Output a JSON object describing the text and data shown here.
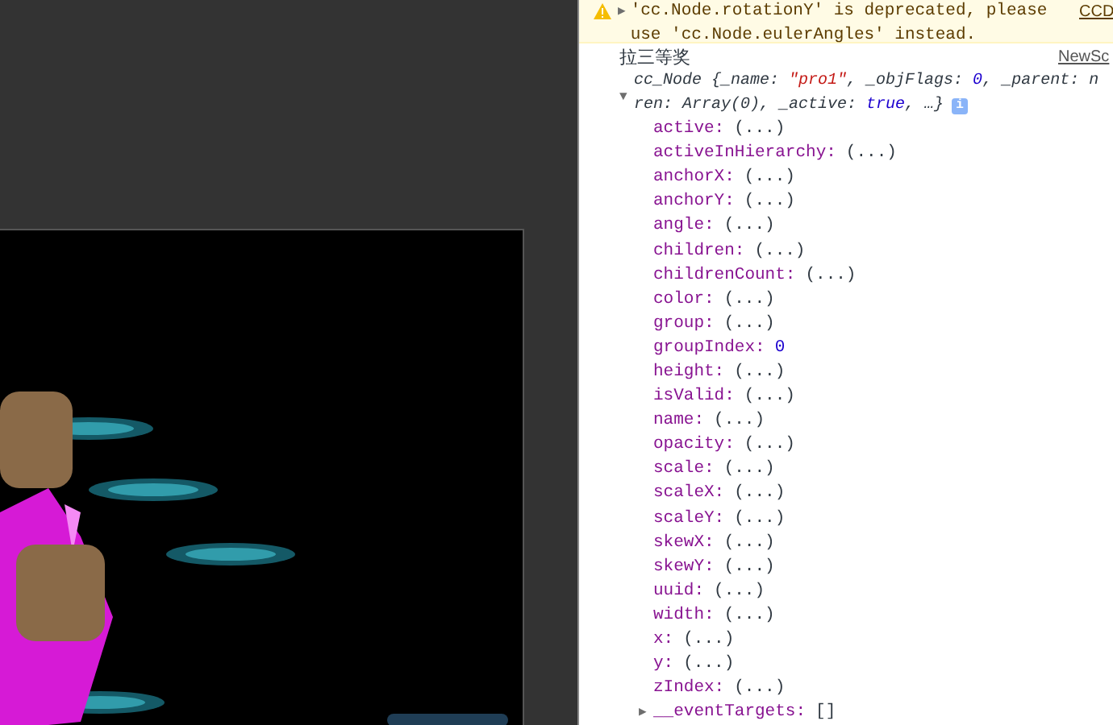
{
  "warning": {
    "expand": "▶",
    "text": "'cc.Node.rotationY' is deprecated, please use 'cc.Node.eulerAngles' instead.",
    "source": "CCD"
  },
  "log": {
    "text": "拉三等奖",
    "source": "NewSc"
  },
  "object": {
    "expanded": true,
    "toggle": "▼",
    "lines": [
      [
        {
          "kind": "plain",
          "text": "cc_Node {_name: "
        },
        {
          "kind": "string",
          "text": "\"pro1\""
        },
        {
          "kind": "plain",
          "text": ", _objFlags: "
        },
        {
          "kind": "number",
          "text": "0"
        },
        {
          "kind": "plain",
          "text": ", _parent: n"
        }
      ],
      [
        {
          "kind": "plain",
          "text": "ren: Array(0), _active: "
        },
        {
          "kind": "number",
          "text": "true"
        },
        {
          "kind": "plain",
          "text": ", …}"
        }
      ]
    ],
    "info": "i",
    "properties": [
      {
        "name": "active:",
        "value": "(...)",
        "kind": "getter"
      },
      {
        "name": "activeInHierarchy:",
        "value": "(...)",
        "kind": "getter"
      },
      {
        "name": "anchorX:",
        "value": "(...)",
        "kind": "getter"
      },
      {
        "name": "anchorY:",
        "value": "(...)",
        "kind": "getter"
      },
      {
        "name": "angle:",
        "value": "(...)",
        "kind": "getter"
      },
      {
        "name": "children:",
        "value": "(...)",
        "kind": "getter"
      },
      {
        "name": "childrenCount:",
        "value": "(...)",
        "kind": "getter"
      },
      {
        "name": "color:",
        "value": "(...)",
        "kind": "getter"
      },
      {
        "name": "group:",
        "value": "(...)",
        "kind": "getter"
      },
      {
        "name": "groupIndex:",
        "value": "0",
        "kind": "number"
      },
      {
        "name": "height:",
        "value": "(...)",
        "kind": "getter"
      },
      {
        "name": "isValid:",
        "value": "(...)",
        "kind": "getter"
      },
      {
        "name": "name:",
        "value": "(...)",
        "kind": "getter"
      },
      {
        "name": "opacity:",
        "value": "(...)",
        "kind": "getter"
      },
      {
        "name": "scale:",
        "value": "(...)",
        "kind": "getter"
      },
      {
        "name": "scaleX:",
        "value": "(...)",
        "kind": "getter"
      },
      {
        "name": "scaleY:",
        "value": "(...)",
        "kind": "getter"
      },
      {
        "name": "skewX:",
        "value": "(...)",
        "kind": "getter"
      },
      {
        "name": "skewY:",
        "value": "(...)",
        "kind": "getter"
      },
      {
        "name": "uuid:",
        "value": "(...)",
        "kind": "getter"
      },
      {
        "name": "width:",
        "value": "(...)",
        "kind": "getter"
      },
      {
        "name": "x:",
        "value": "(...)",
        "kind": "getter"
      },
      {
        "name": "y:",
        "value": "(...)",
        "kind": "getter"
      },
      {
        "name": "zIndex:",
        "value": "(...)",
        "kind": "getter"
      },
      {
        "name": "__eventTargets:",
        "value": "[]",
        "kind": "array",
        "expanded": false,
        "toggle": "▶"
      }
    ]
  }
}
